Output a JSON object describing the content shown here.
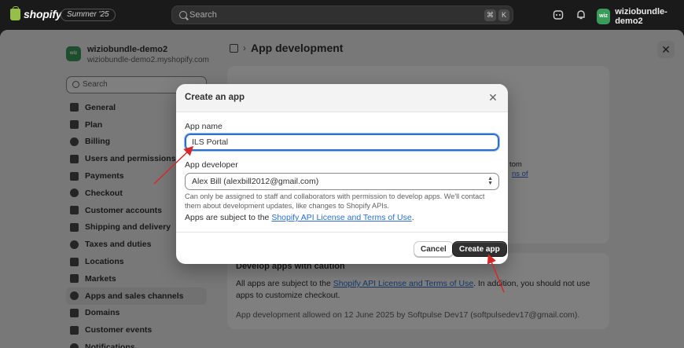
{
  "topbar": {
    "brand": "shopify",
    "edition_badge": "Summer '25",
    "search_placeholder": "Search",
    "shortcut_cmd": "⌘",
    "shortcut_key": "K",
    "store_initials": "wiz",
    "store_name": "wiziobundle-demo2"
  },
  "settings": {
    "shop_initials": "wiz",
    "shop_name": "wiziobundle-demo2",
    "shop_domain": "wiziobundle-demo2.myshopify.com",
    "search_placeholder": "Search",
    "nav": [
      {
        "label": "General",
        "icon": "store-icon"
      },
      {
        "label": "Plan",
        "icon": "plan-icon"
      },
      {
        "label": "Billing",
        "icon": "billing-icon"
      },
      {
        "label": "Users and permissions",
        "icon": "users-icon"
      },
      {
        "label": "Payments",
        "icon": "payments-icon"
      },
      {
        "label": "Checkout",
        "icon": "cart-icon"
      },
      {
        "label": "Customer accounts",
        "icon": "person-icon"
      },
      {
        "label": "Shipping and delivery",
        "icon": "truck-icon"
      },
      {
        "label": "Taxes and duties",
        "icon": "tax-icon"
      },
      {
        "label": "Locations",
        "icon": "location-icon"
      },
      {
        "label": "Markets",
        "icon": "globe-icon"
      },
      {
        "label": "Apps and sales channels",
        "icon": "apps-icon",
        "active": true
      },
      {
        "label": "Domains",
        "icon": "globe-icon"
      },
      {
        "label": "Customer events",
        "icon": "events-icon"
      },
      {
        "label": "Notifications",
        "icon": "bell-icon"
      }
    ]
  },
  "page": {
    "title": "App development",
    "close_symbol": "✕",
    "peek_fragment_a": "tom",
    "peek_fragment_b": "ns of"
  },
  "caution_card": {
    "heading": "Develop apps with caution",
    "text_before": "All apps are subject to the ",
    "link": "Shopify API License and Terms of Use",
    "text_after": ". In addition, you should not use apps to customize checkout.",
    "allowed_note": "App development allowed on 12 June 2025 by Softpulse Dev17 (softpulsedev17@gmail.com)."
  },
  "modal": {
    "title": "Create an app",
    "close_symbol": "✕",
    "app_name_label": "App name",
    "app_name_value": "ILS Portal",
    "developer_label": "App developer",
    "developer_value": "Alex Bill (alexbill2012@gmail.com)",
    "developer_help": "Can only be assigned to staff and collaborators with permission to develop apps. We'll contact them about development updates, like changes to Shopify APIs.",
    "terms_prefix": "Apps are subject to the ",
    "terms_link": "Shopify API License and Terms of Use",
    "terms_suffix": ".",
    "cancel_label": "Cancel",
    "create_label": "Create app"
  },
  "colors": {
    "accent_link": "#2c6ecb",
    "primary_button": "#303030",
    "annotation_arrow": "#d62828"
  }
}
